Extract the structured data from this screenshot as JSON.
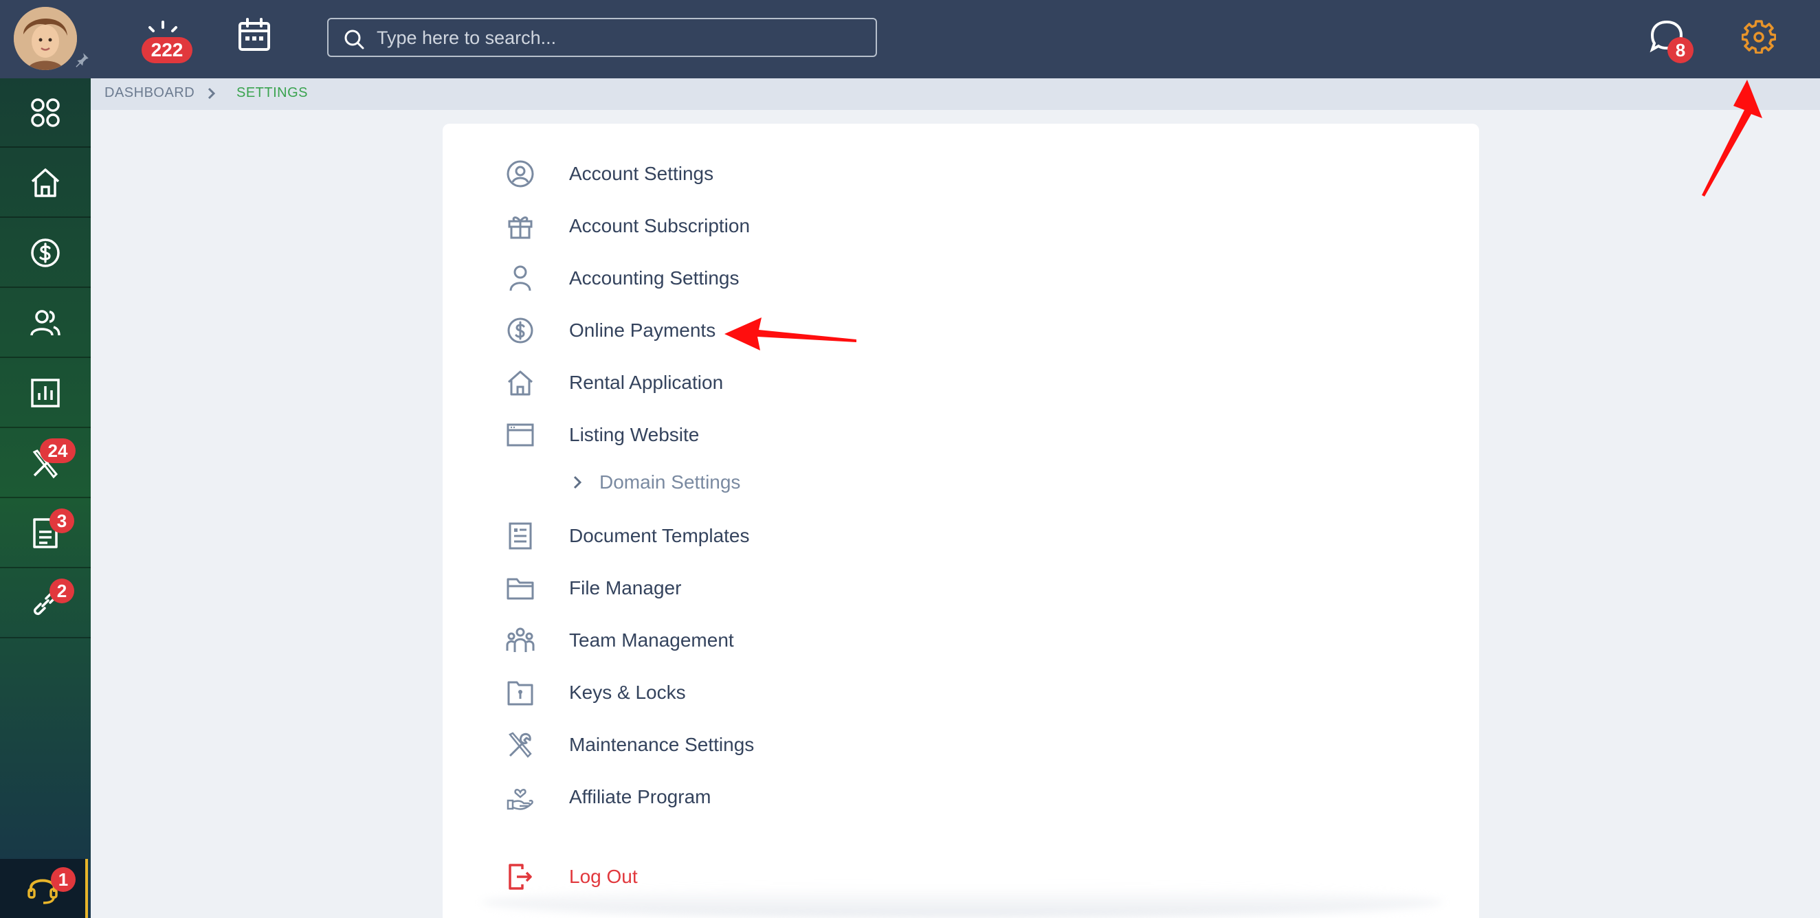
{
  "header": {
    "alerts_count": "222",
    "search_placeholder": "Type here to search...",
    "messages_count": "8"
  },
  "breadcrumb": {
    "items": [
      "DASHBOARD",
      "SETTINGS"
    ]
  },
  "sidebar": {
    "items": [
      {
        "icon": "apps-icon"
      },
      {
        "icon": "home-icon"
      },
      {
        "icon": "dollar-icon"
      },
      {
        "icon": "people-icon"
      },
      {
        "icon": "chart-icon"
      },
      {
        "icon": "tools-icon",
        "badge": "24"
      },
      {
        "icon": "document-icon",
        "badge": "3"
      },
      {
        "icon": "link-icon",
        "badge": "2"
      }
    ],
    "support_badge": "1"
  },
  "settings_menu": {
    "items": [
      {
        "label": "Account Settings",
        "icon": "user-circle-icon"
      },
      {
        "label": "Account Subscription",
        "icon": "gift-icon"
      },
      {
        "label": "Accounting Settings",
        "icon": "user-icon"
      },
      {
        "label": "Online Payments",
        "icon": "dollar-circle-icon"
      },
      {
        "label": "Rental Application",
        "icon": "house-icon"
      },
      {
        "label": "Listing Website",
        "icon": "browser-window-icon"
      },
      {
        "label": "Domain Settings",
        "icon": "chevron-right-icon"
      },
      {
        "label": "Document Templates",
        "icon": "document-icon"
      },
      {
        "label": "File Manager",
        "icon": "folder-icon"
      },
      {
        "label": "Team Management",
        "icon": "team-icon"
      },
      {
        "label": "Keys & Locks",
        "icon": "key-folder-icon"
      },
      {
        "label": "Maintenance Settings",
        "icon": "tools-icon"
      },
      {
        "label": "Affiliate Program",
        "icon": "heart-hand-icon"
      },
      {
        "label": "Log Out",
        "icon": "logout-icon"
      }
    ]
  },
  "colors": {
    "header_bg": "#34435d",
    "accent_green": "#3aa34f",
    "badge_red": "#e1383d",
    "gear_orange": "#e8942a",
    "icon_gray": "#7a8aa1",
    "text_dark": "#34435d"
  }
}
